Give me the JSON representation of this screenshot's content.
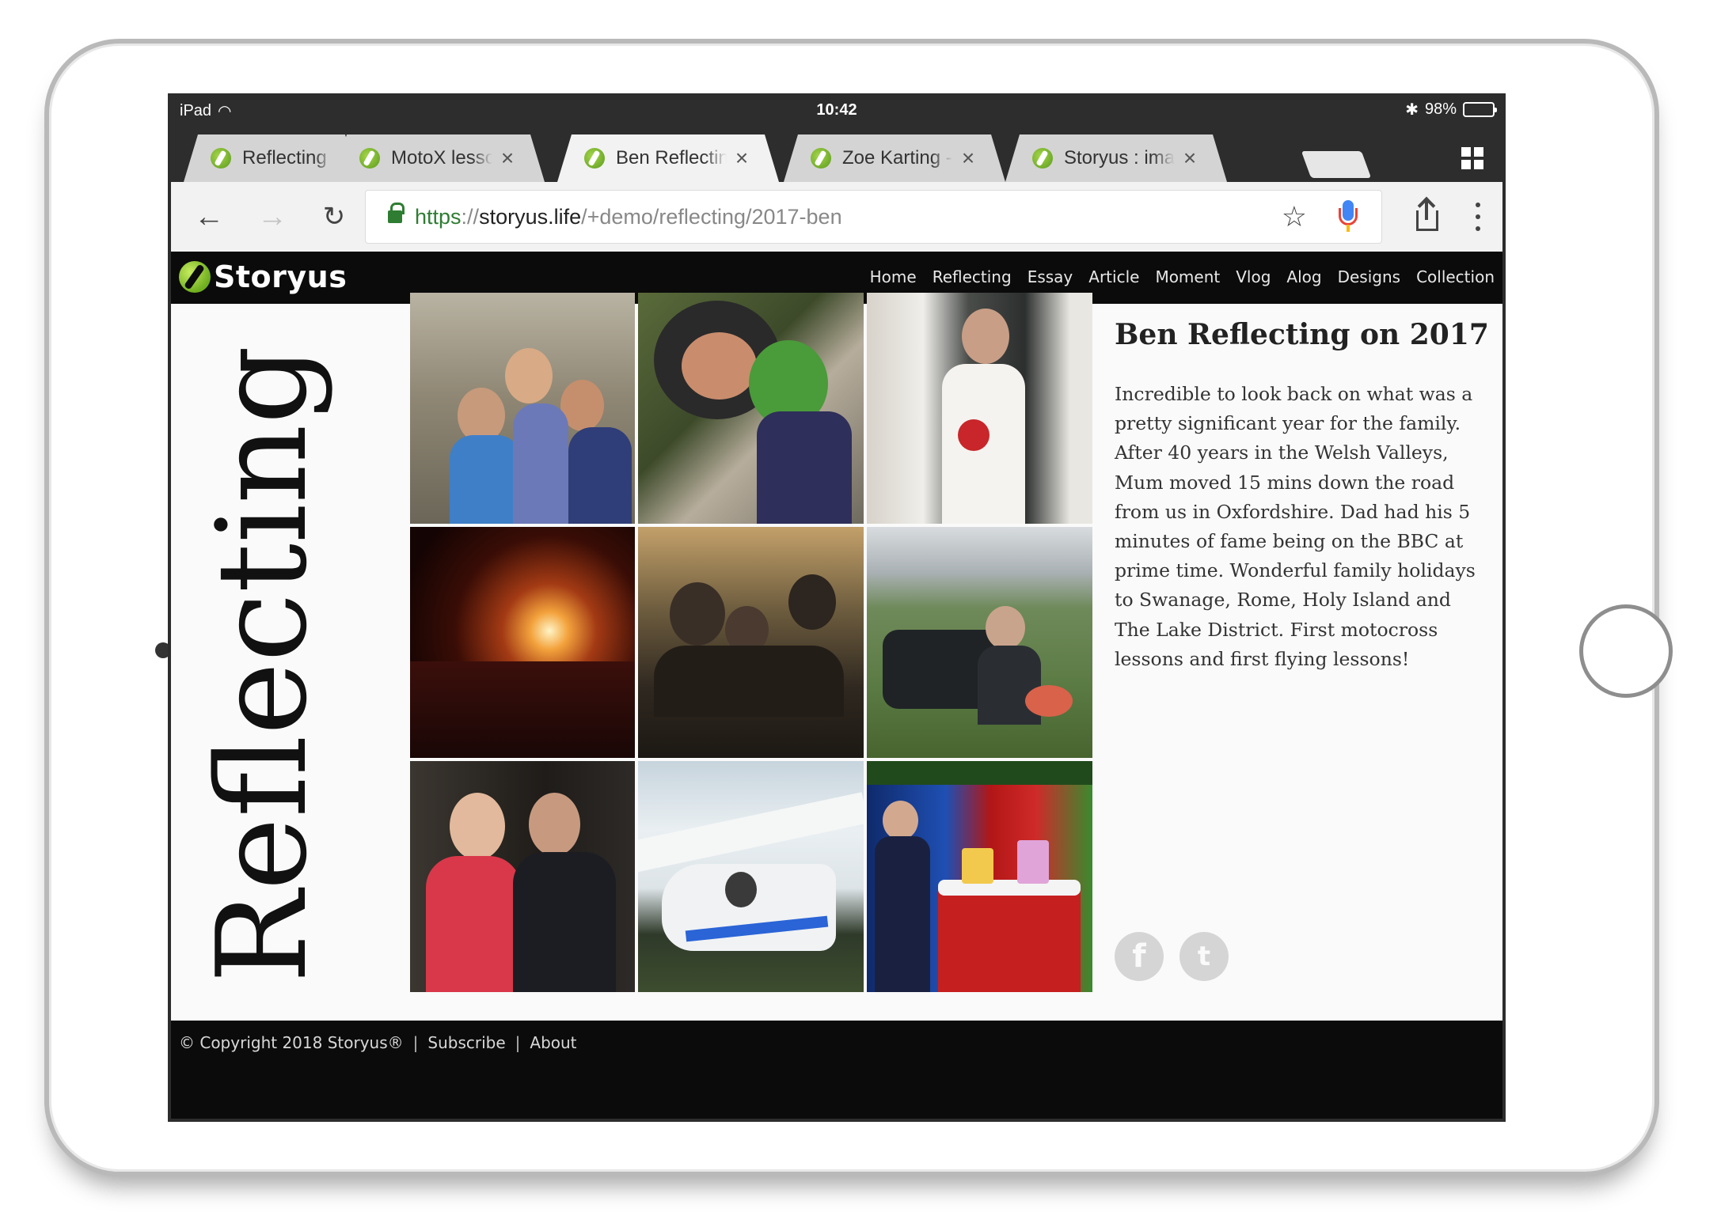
{
  "status_bar": {
    "carrier": "iPad",
    "time": "10:42",
    "battery": "98%",
    "battery_level": 0.98
  },
  "tabs": [
    {
      "title": "Reflecting on t"
    },
    {
      "title": "MotoX lessons wi"
    },
    {
      "title": "Ben Reflecting on"
    },
    {
      "title": "Zoe Karting - first"
    },
    {
      "title": "Storyus : image C"
    }
  ],
  "address_bar": {
    "scheme": "https",
    "separator": "://",
    "host": "storyus.life",
    "path": "/+demo/reflecting/2017-ben"
  },
  "site": {
    "logo_text": "Storyus",
    "nav": [
      "Home",
      "Reflecting",
      "Essay",
      "Article",
      "Moment",
      "Vlog",
      "Alog",
      "Designs",
      "Collection"
    ]
  },
  "page": {
    "vertical_heading": "Reflecting",
    "title": "Ben Reflecting on 2017",
    "body": "Incredible to look back on what was a pretty significant year for the family. After 40 years in the Welsh Valleys, Mum moved 15 mins down the road from us in Oxfordshire. Dad had his 5 minutes of fame being on the BBC at prime time. Wonderful family holidays to Swanage, Rome, Holy Island and The Lake District. First motocross lessons and first flying lessons!"
  },
  "social": {
    "facebook": "f",
    "twitter": "t"
  },
  "footer": {
    "copyright": "© Copyright 2018 Storyus®",
    "links": [
      "Subscribe",
      "About"
    ]
  }
}
